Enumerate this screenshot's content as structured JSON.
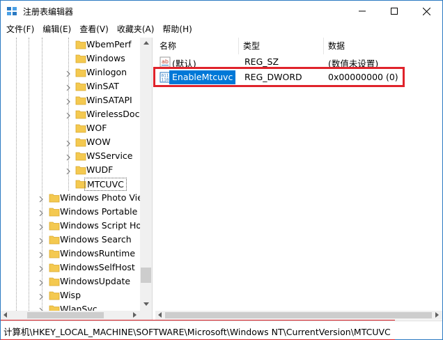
{
  "window": {
    "title": "注册表编辑器"
  },
  "menu": [
    {
      "label": "文件(F)"
    },
    {
      "label": "编辑(E)"
    },
    {
      "label": "查看(V)"
    },
    {
      "label": "收藏夹(A)"
    },
    {
      "label": "帮助(H)"
    }
  ],
  "tree": {
    "items": [
      {
        "label": "WbemPerf",
        "expandable": false
      },
      {
        "label": "Windows",
        "expandable": false
      },
      {
        "label": "Winlogon",
        "expandable": true
      },
      {
        "label": "WinSAT",
        "expandable": true
      },
      {
        "label": "WinSATAPI",
        "expandable": true
      },
      {
        "label": "WirelessDoc",
        "expandable": true
      },
      {
        "label": "WOF",
        "expandable": false
      },
      {
        "label": "WOW",
        "expandable": true
      },
      {
        "label": "WSService",
        "expandable": true
      },
      {
        "label": "WUDF",
        "expandable": true
      },
      {
        "label": "MTCUVC",
        "expandable": false,
        "selected": true
      },
      {
        "label": "Windows Photo Vie",
        "expandable": true
      },
      {
        "label": "Windows Portable",
        "expandable": true
      },
      {
        "label": "Windows Script Ho",
        "expandable": true
      },
      {
        "label": "Windows Search",
        "expandable": true
      },
      {
        "label": "WindowsRuntime",
        "expandable": true
      },
      {
        "label": "WindowsSelfHost",
        "expandable": true
      },
      {
        "label": "WindowsUpdate",
        "expandable": true
      },
      {
        "label": "Wisp",
        "expandable": true
      },
      {
        "label": "WlanSvc",
        "expandable": true
      }
    ]
  },
  "values_table": {
    "headers": {
      "name": "名称",
      "type": "类型",
      "data": "数据"
    },
    "rows": [
      {
        "name": "(默认)",
        "type": "REG_SZ",
        "data": "(数值未设置)",
        "icon": "string-value-icon"
      },
      {
        "name": "EnableMtcuvc",
        "type": "REG_DWORD",
        "data": "0x00000000 (0)",
        "icon": "binary-value-icon",
        "editing": true
      }
    ]
  },
  "status": {
    "path": "计算机\\HKEY_LOCAL_MACHINE\\SOFTWARE\\Microsoft\\Windows NT\\CurrentVersion\\MTCUVC"
  },
  "colors": {
    "highlight_box": "#e0232b",
    "edit_selection": "#0078d7",
    "folder": "#f4c950"
  }
}
